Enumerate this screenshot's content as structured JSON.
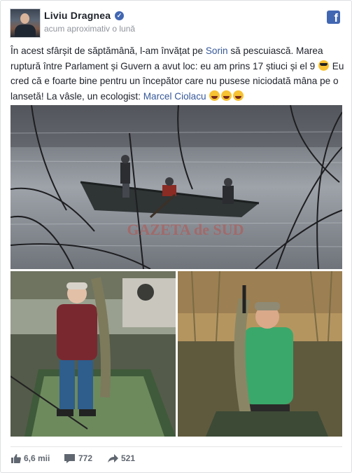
{
  "post": {
    "author": "Liviu Dragnea",
    "timestamp": "acum aproximativ o lună",
    "text_part1": "În acest sfârșit de săptămână, l-am învățat pe ",
    "mention_sorin": "Sorin",
    "text_part2": " să pescuiască. Marea ruptură între Parlament și Guvern a avut loc: eu am prins 17 știuci și el 9 ",
    "text_part3": " Eu cred că e foarte bine pentru un începător care nu pusese niciodată mâna pe o lansetă! La vâsle, un ecologist: ",
    "mention_marcel": "Marcel Ciolacu",
    "watermark": "GAZETA de SUD"
  },
  "icons": {
    "verified": "verified-badge-icon",
    "platform": "facebook-icon",
    "like": "thumbs-up-icon",
    "comment": "comment-icon",
    "share": "share-arrow-icon"
  },
  "stats": {
    "likes": "6,6 mii",
    "comments": "772",
    "shares": "521"
  },
  "colors": {
    "link": "#365899",
    "brand": "#4267b2",
    "muted": "#90949c"
  }
}
